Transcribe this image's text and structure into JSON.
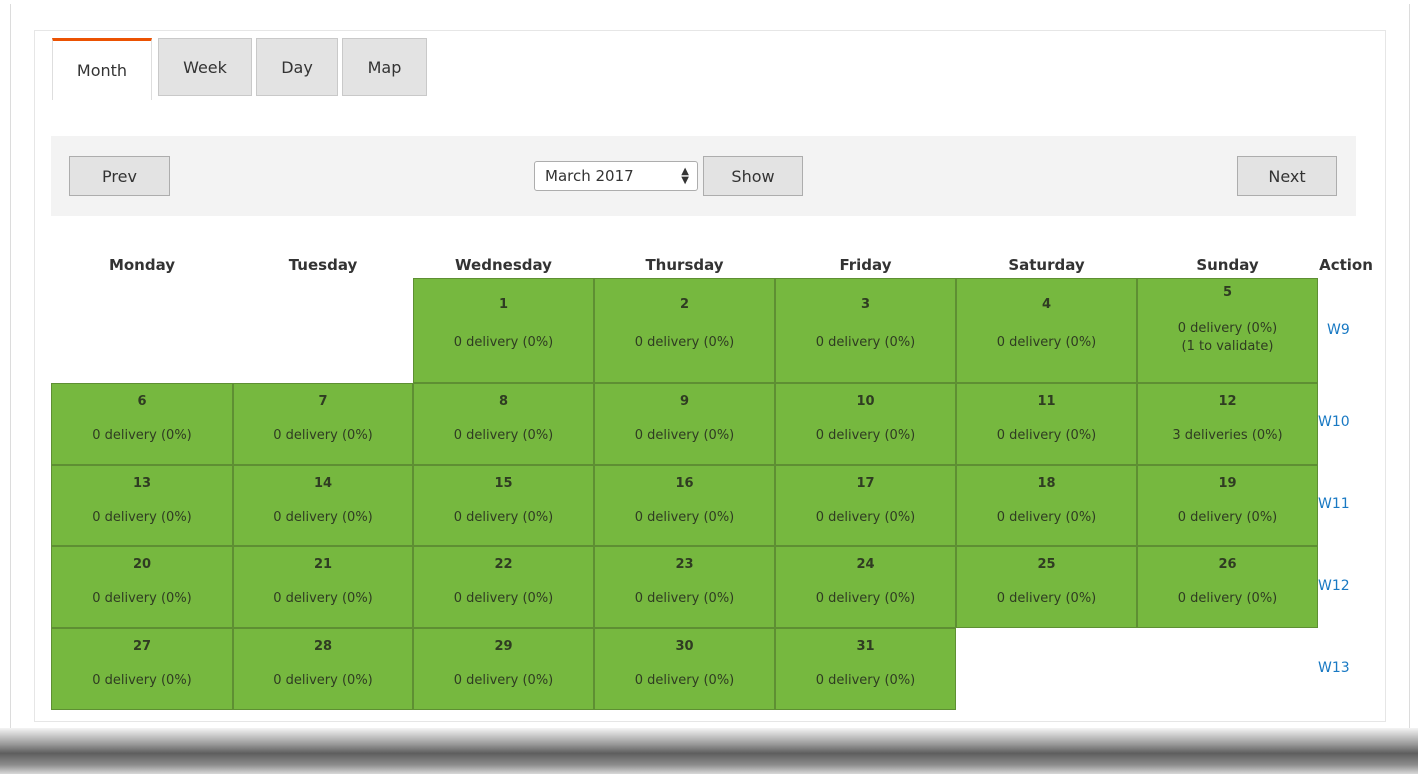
{
  "tabs": [
    {
      "label": "Month",
      "active": true
    },
    {
      "label": "Week",
      "active": false
    },
    {
      "label": "Day",
      "active": false
    },
    {
      "label": "Map",
      "active": false
    }
  ],
  "toolbar": {
    "prev_label": "Prev",
    "next_label": "Next",
    "show_label": "Show",
    "month_select": "March 2017"
  },
  "calendar": {
    "day_headers": [
      "Monday",
      "Tuesday",
      "Wednesday",
      "Thursday",
      "Friday",
      "Saturday",
      "Sunday"
    ],
    "action_header": "Action",
    "weeks": [
      {
        "link": "W9",
        "days": [
          null,
          null,
          {
            "num": "1",
            "info": "0 delivery (0%)"
          },
          {
            "num": "2",
            "info": "0 delivery (0%)"
          },
          {
            "num": "3",
            "info": "0 delivery (0%)"
          },
          {
            "num": "4",
            "info": "0 delivery (0%)"
          },
          {
            "num": "5",
            "info": "0 delivery (0%)",
            "extra": "(1 to validate)"
          }
        ]
      },
      {
        "link": "W10",
        "days": [
          {
            "num": "6",
            "info": "0 delivery (0%)"
          },
          {
            "num": "7",
            "info": "0 delivery (0%)"
          },
          {
            "num": "8",
            "info": "0 delivery (0%)"
          },
          {
            "num": "9",
            "info": "0 delivery (0%)"
          },
          {
            "num": "10",
            "info": "0 delivery (0%)"
          },
          {
            "num": "11",
            "info": "0 delivery (0%)"
          },
          {
            "num": "12",
            "info": "3 deliveries (0%)"
          }
        ]
      },
      {
        "link": "W11",
        "days": [
          {
            "num": "13",
            "info": "0 delivery (0%)"
          },
          {
            "num": "14",
            "info": "0 delivery (0%)"
          },
          {
            "num": "15",
            "info": "0 delivery (0%)"
          },
          {
            "num": "16",
            "info": "0 delivery (0%)"
          },
          {
            "num": "17",
            "info": "0 delivery (0%)"
          },
          {
            "num": "18",
            "info": "0 delivery (0%)"
          },
          {
            "num": "19",
            "info": "0 delivery (0%)"
          }
        ]
      },
      {
        "link": "W12",
        "days": [
          {
            "num": "20",
            "info": "0 delivery (0%)"
          },
          {
            "num": "21",
            "info": "0 delivery (0%)"
          },
          {
            "num": "22",
            "info": "0 delivery (0%)"
          },
          {
            "num": "23",
            "info": "0 delivery (0%)"
          },
          {
            "num": "24",
            "info": "0 delivery (0%)"
          },
          {
            "num": "25",
            "info": "0 delivery (0%)"
          },
          {
            "num": "26",
            "info": "0 delivery (0%)"
          }
        ]
      },
      {
        "link": "W13",
        "days": [
          {
            "num": "27",
            "info": "0 delivery (0%)"
          },
          {
            "num": "28",
            "info": "0 delivery (0%)"
          },
          {
            "num": "29",
            "info": "0 delivery (0%)"
          },
          {
            "num": "30",
            "info": "0 delivery (0%)"
          },
          {
            "num": "31",
            "info": "0 delivery (0%)"
          },
          null,
          null
        ]
      }
    ]
  },
  "colors": {
    "day_cell": "#76b83f",
    "active_tab_accent": "#eb5202",
    "week_link": "#1979c3"
  }
}
